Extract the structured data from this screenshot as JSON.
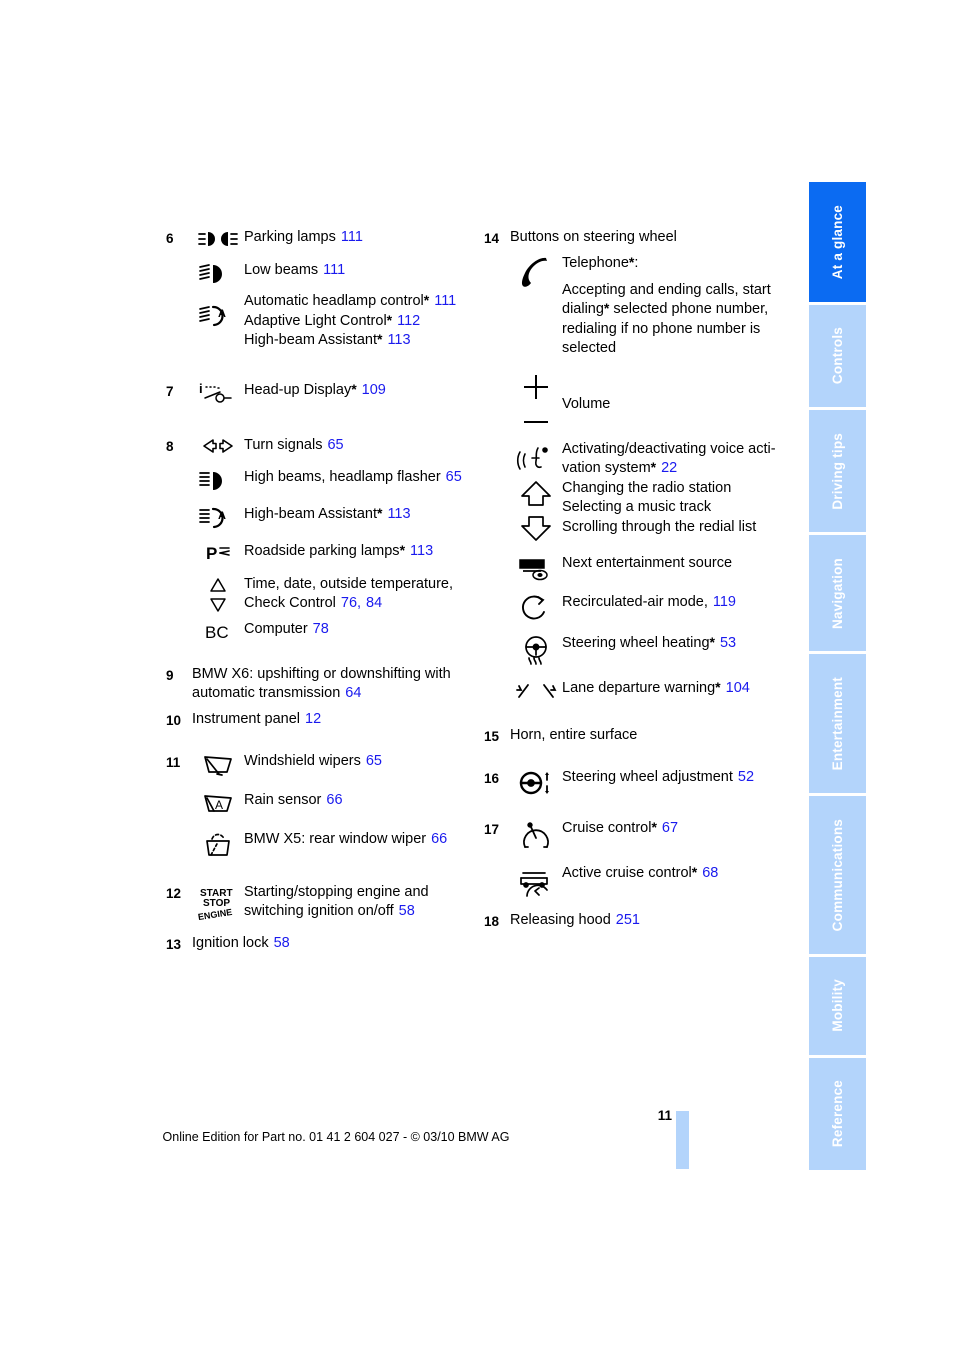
{
  "document": {
    "page_number": "11",
    "footer_text": "Online Edition for Part no. 01 41 2 604 027 - © 03/10 BMW AG"
  },
  "colors": {
    "link_blue": "#1a1aee",
    "tab_active": "#0b6bf2",
    "tab_inactive": "#b3d4fb",
    "tab_text": "#ffffff"
  },
  "tabs": [
    {
      "label": "At a glance",
      "active": true
    },
    {
      "label": "Controls",
      "active": false
    },
    {
      "label": "Driving tips",
      "active": false
    },
    {
      "label": "Navigation",
      "active": false
    },
    {
      "label": "Entertainment",
      "active": false
    },
    {
      "label": "Communications",
      "active": false
    },
    {
      "label": "Mobility",
      "active": false
    },
    {
      "label": "Reference",
      "active": false
    }
  ],
  "left_column": {
    "item6": {
      "index": "6",
      "entries": [
        {
          "icon": "parking-lamps-icon",
          "label": "Parking lamps",
          "page": "111"
        },
        {
          "icon": "low-beams-icon",
          "label": "Low beams",
          "page": "111"
        },
        {
          "icon": "automatic-headlamp-control-icon",
          "lines": [
            {
              "label": "Automatic headlamp control",
              "star": "*",
              "page": "111"
            },
            {
              "label": "Adaptive Light Control",
              "star": "*",
              "page": "112"
            },
            {
              "label": "High-beam Assistant",
              "star": "*",
              "page": "113"
            }
          ]
        }
      ]
    },
    "item7": {
      "index": "7",
      "icon": "head-up-display-icon",
      "label": "Head-up Display",
      "star": "*",
      "page": "109"
    },
    "item8": {
      "index": "8",
      "entries": [
        {
          "icon": "turn-signals-icon",
          "label": "Turn signals",
          "page": "65"
        },
        {
          "icon": "high-beams-icon",
          "label": "High beams, headlamp flasher",
          "page": "65"
        },
        {
          "icon": "high-beam-assistant-icon",
          "label": "High-beam Assistant",
          "star": "*",
          "page": "113"
        },
        {
          "icon": "roadside-parking-lamps-icon",
          "label": "Roadside parking lamps",
          "star": "*",
          "page": "113"
        },
        {
          "icon": "up-down-triangles-icon",
          "line1": "Time, date, outside temperature,",
          "line2": "Check Control",
          "page": "76",
          "page2": "84"
        },
        {
          "icon": "bc-computer-icon",
          "label": "Computer",
          "page": "78"
        }
      ]
    },
    "item9": {
      "index": "9",
      "line1": "BMW X6: upshifting or downshifting with",
      "line2": "automatic transmission",
      "page": "64"
    },
    "item10": {
      "index": "10",
      "label": "Instrument panel",
      "page": "12"
    },
    "item11": {
      "index": "11",
      "entries": [
        {
          "icon": "windshield-wipers-icon",
          "label": "Windshield wipers",
          "page": "65"
        },
        {
          "icon": "rain-sensor-icon",
          "label": "Rain sensor",
          "page": "66"
        },
        {
          "icon": "rear-window-wiper-icon",
          "label": "BMW X5: rear window wiper",
          "page": "66"
        }
      ]
    },
    "item12": {
      "index": "12",
      "icon": "start-stop-engine-icon",
      "icon_text_1": "START",
      "icon_text_2": "STOP",
      "icon_text_3": "ENGINE",
      "line1": "Starting/stopping engine and",
      "line2": "switching ignition on/off",
      "page": "58"
    },
    "item13": {
      "index": "13",
      "label": "Ignition lock",
      "page": "58"
    }
  },
  "right_column": {
    "item14": {
      "index": "14",
      "heading": "Buttons on steering wheel",
      "entries": [
        {
          "icon": "telephone-icon",
          "label": "Telephone",
          "star": "*",
          "colon": ":",
          "body": [
            "Accepting and ending calls, start",
            "dialing* selected phone number,",
            "redialing if no phone number is",
            "selected"
          ],
          "body_line2_pre": "dialing",
          "body_line2_star": "*",
          "body_line2_post": " selected phone number,"
        },
        {
          "icon": "volume-plus-minus-icon",
          "label": "Volume"
        },
        {
          "icon": "voice-activation-icon",
          "line1": "Activating/deactivating voice acti-",
          "line2": "vation system",
          "star": "*",
          "page": "22"
        },
        {
          "icon": "up-arrow-down-arrow-icon",
          "line1": "Changing the radio station",
          "line2": "Selecting a music track",
          "line3": "Scrolling through the redial list"
        },
        {
          "icon": "entertainment-source-icon",
          "label": "Next entertainment source"
        },
        {
          "icon": "recirculated-air-icon",
          "label": "Recirculated-air mode,",
          "page": "119"
        },
        {
          "icon": "steering-wheel-heating-icon",
          "label": "Steering wheel heating",
          "star": "*",
          "page": "53"
        },
        {
          "icon": "lane-departure-warning-icon",
          "label": "Lane departure warning",
          "star": "*",
          "page": "104"
        }
      ]
    },
    "item15": {
      "index": "15",
      "label": "Horn, entire surface"
    },
    "item16": {
      "index": "16",
      "icon": "steering-wheel-adjustment-icon",
      "label": "Steering wheel adjustment",
      "page": "52"
    },
    "item17": {
      "index": "17",
      "entries": [
        {
          "icon": "cruise-control-icon",
          "label": "Cruise control",
          "star": "*",
          "page": "67"
        },
        {
          "icon": "active-cruise-control-icon",
          "label": "Active cruise control",
          "star": "*",
          "page": "68"
        }
      ]
    },
    "item18": {
      "index": "18",
      "label": "Releasing hood",
      "page": "251"
    }
  }
}
